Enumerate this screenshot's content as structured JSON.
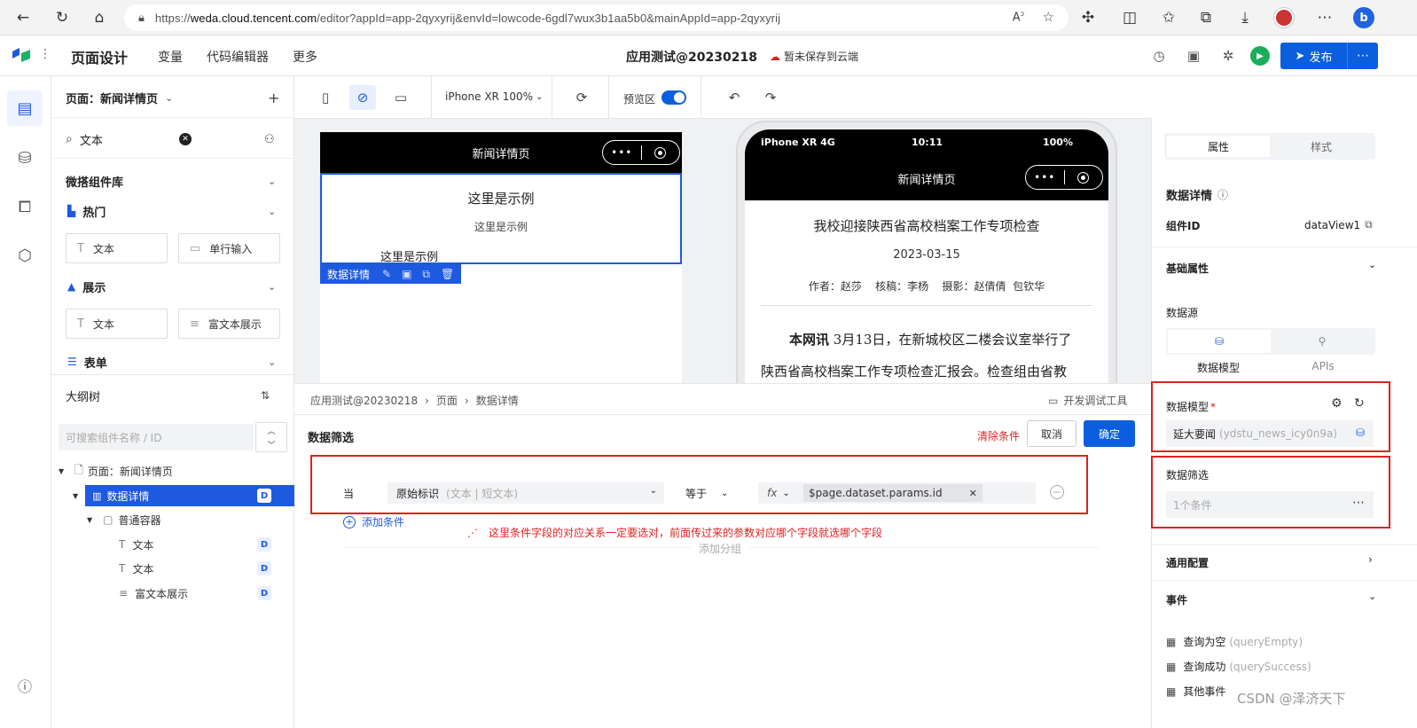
{
  "browser": {
    "url_prefix": "https://",
    "url_host": "weda.cloud.tencent.com",
    "url_path": "/editor?appId=app-2qyxyrij&envId=lowcode-6gdl7wux3b1aa5b0&mainAppId=app-2qyxyrij"
  },
  "header": {
    "title": "页面设计",
    "menu": [
      "变量",
      "代码编辑器",
      "更多"
    ],
    "app_name": "应用测试@20230218",
    "save_status": "暂未保存到云端",
    "publish_label": "发布"
  },
  "left_panel": {
    "page_selector": "页面：新闻详情页",
    "search_value": "文本",
    "library_title": "微搭组件库",
    "groups": [
      {
        "name": "热门",
        "items": [
          "文本",
          "单行输入"
        ]
      },
      {
        "name": "展示",
        "items": [
          "文本",
          "富文本展示"
        ]
      },
      {
        "name": "表单",
        "items": []
      }
    ],
    "outline_title": "大纲树",
    "outline_search_placeholder": "可搜索组件名称 / ID",
    "tree": [
      {
        "label": "页面：新闻详情页",
        "badge": ""
      },
      {
        "label": "数据详情",
        "badge": "D"
      },
      {
        "label": "普通容器",
        "badge": ""
      },
      {
        "label": "文本",
        "badge": "D"
      },
      {
        "label": "文本",
        "badge": "D"
      },
      {
        "label": "富文本展示",
        "badge": "D"
      }
    ]
  },
  "toolbar": {
    "device": "iPhone XR 100%",
    "preview_label": "预览区",
    "preview_on": true
  },
  "canvas": {
    "left_phone": {
      "title": "新闻详情页",
      "text1": "这里是示例",
      "text2": "这里是示例",
      "text3": "这里是示例",
      "selection_label": "数据详情"
    },
    "right_phone": {
      "status_left": "iPhone XR  4G",
      "status_time": "10:11",
      "status_battery": "100%",
      "title": "新闻详情页",
      "article_title": "我校迎接陕西省高校档案工作专项检查",
      "article_date": "2023-03-15",
      "article_meta": "作者：赵莎    核稿：李杨    摄影：赵倩倩  包钦华",
      "article_lead": "本网讯",
      "article_line1": " 3月13日，在新城校区二楼会议室举行了",
      "article_line2": "陕西省高校档案工作专项检查汇报会。检查组由省教"
    }
  },
  "bottom": {
    "breadcrumb": [
      "应用测试@20230218",
      "页面",
      "数据详情"
    ],
    "dev_tools": "开发调试工具",
    "panel_title": "数据筛选",
    "clear_label": "清除条件",
    "cancel_label": "取消",
    "confirm_label": "确定",
    "when_label": "当",
    "field_value": "原始标识",
    "field_type": "(文本 | 短文本)",
    "operator": "等于",
    "fx_label": "fx",
    "param_value": "$page.dataset.params.id",
    "add_condition": "添加条件",
    "add_group": "添加分组",
    "annotation": "这里条件字段的对应关系一定要选对，前面传过来的参数对应哪个字段就选哪个字段"
  },
  "right_panel": {
    "tabs": [
      "属性",
      "样式"
    ],
    "component_name": "数据详情",
    "component_id_label": "组件ID",
    "component_id": "dataView1",
    "basic_props": "基础属性",
    "datasource_label": "数据源",
    "datasource_options": [
      "数据模型",
      "APIs"
    ],
    "data_model_label": "数据模型",
    "data_model_value": "延大要闻",
    "data_model_id": "(ydstu_news_icy0n9a)",
    "filter_label": "数据筛选",
    "filter_value": "1个条件",
    "general_config": "通用配置",
    "events_label": "事件",
    "events": [
      {
        "name": "查询为空",
        "code": "(queryEmpty)"
      },
      {
        "name": "查询成功",
        "code": "(querySuccess)"
      },
      {
        "name": "其他事件",
        "code": ""
      }
    ]
  },
  "watermark": "CSDN @泽济天下",
  "colors": {
    "primary": "#0b5fde",
    "annotation_red": "#e02020",
    "run_green": "#1aad5a"
  }
}
